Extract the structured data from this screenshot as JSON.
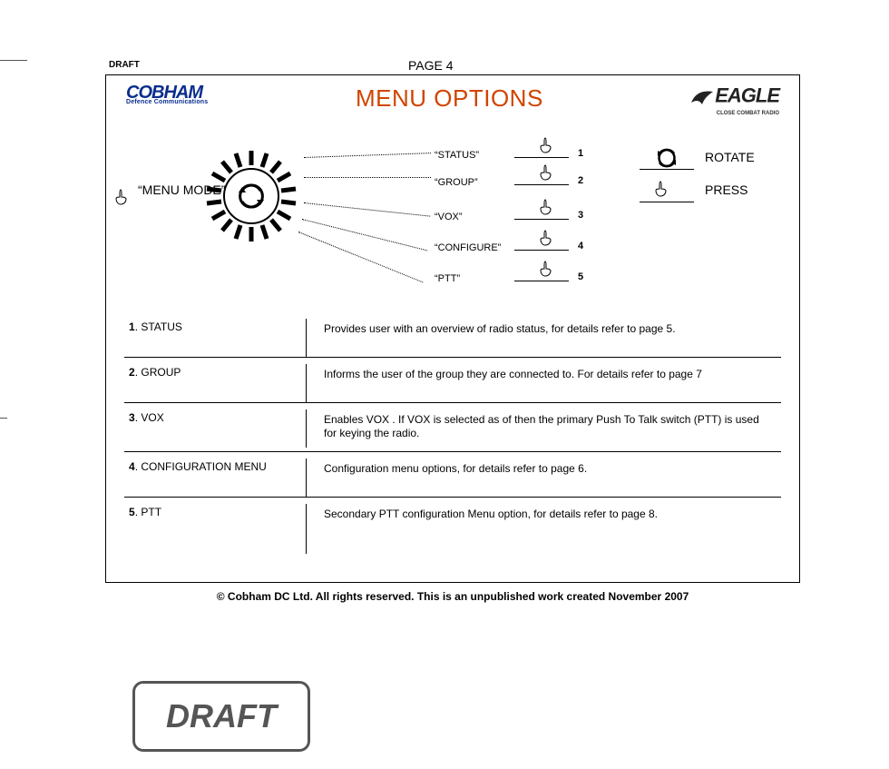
{
  "header": {
    "draft_small": "DRAFT",
    "page_label": "PAGE 4",
    "title": "MENU OPTIONS"
  },
  "logo_left": {
    "brand": "COBHAM",
    "sub": "Defence Communications"
  },
  "logo_right": {
    "brand": "EAGLE",
    "sub": "CLOSE COMBAT RADIO"
  },
  "diagram": {
    "menu_mode": "“MENU MODE”",
    "options": [
      {
        "label": "“STATUS”",
        "num": "1"
      },
      {
        "label": "“GROUP”",
        "num": "2"
      },
      {
        "label": "“VOX”",
        "num": "3"
      },
      {
        "label": "“CONFIGURE”",
        "num": "4"
      },
      {
        "label": "“PTT”",
        "num": "5"
      }
    ],
    "legend": {
      "rotate": "ROTATE",
      "press": "PRESS"
    }
  },
  "table": {
    "rows": [
      {
        "num": "1",
        "name": "STATUS",
        "desc": "Provides user with an overview of radio status, for details refer to page 5."
      },
      {
        "num": "2",
        "name": "GROUP",
        "desc": "Informs the user of the group they are connected to. For details refer to page 7"
      },
      {
        "num": "3",
        "name": "VOX",
        "desc": "Enables VOX . If VOX is selected as of then the primary Push To Talk switch (PTT) is used for keying the radio."
      },
      {
        "num": "4",
        "name": "CONFIGURATION MENU",
        "desc": "Configuration menu options, for details refer to page 6."
      },
      {
        "num": "5",
        "name": "PTT",
        "desc": "Secondary PTT configuration Menu option, for details refer to page 8."
      }
    ]
  },
  "copyright": "© Cobham DC Ltd. All rights reserved. This is an unpublished work created November 2007",
  "stamp": "DRAFT"
}
